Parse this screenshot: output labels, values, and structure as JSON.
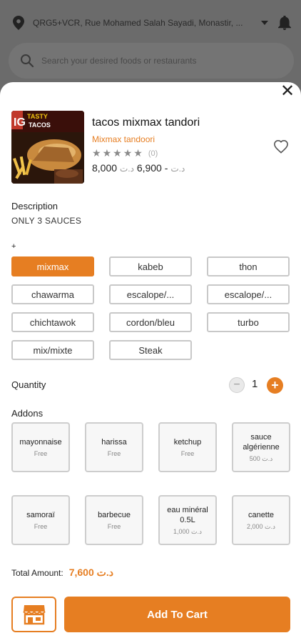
{
  "header": {
    "location": "QRG5+VCR, Rue Mohamed Salah Sayadi, Monastir, ...",
    "search_placeholder": "Search your desired foods or restaurants"
  },
  "product": {
    "name": "tacos mixmax tandori",
    "restaurant": "Mixmax tandoori",
    "rating_count": "(0)",
    "price_max": "8,000",
    "price_min": "6,900",
    "currency": "د.ت",
    "image_brand_line1": "TASTY",
    "image_brand_line2": "TACOS",
    "image_brand_prefix": "IG"
  },
  "description": {
    "label": "Description",
    "text": "ONLY 3 SAUCES"
  },
  "options": {
    "label": "+",
    "items": [
      {
        "label": "mixmax",
        "selected": true
      },
      {
        "label": "kabeb",
        "selected": false
      },
      {
        "label": "thon",
        "selected": false
      },
      {
        "label": "chawarma",
        "selected": false
      },
      {
        "label": "escalope/...",
        "selected": false
      },
      {
        "label": "escalope/...",
        "selected": false
      },
      {
        "label": "chichtawok",
        "selected": false
      },
      {
        "label": "cordon/bleu",
        "selected": false
      },
      {
        "label": "turbo",
        "selected": false
      },
      {
        "label": "mix/mixte",
        "selected": false
      },
      {
        "label": "Steak",
        "selected": false
      }
    ]
  },
  "quantity": {
    "label": "Quantity",
    "value": "1",
    "minus": "−",
    "plus": "+"
  },
  "addons": {
    "label": "Addons",
    "items": [
      {
        "name": "mayonnaise",
        "price": "Free"
      },
      {
        "name": "harissa",
        "price": "Free"
      },
      {
        "name": "ketchup",
        "price": "Free"
      },
      {
        "name": "sauce algérienne",
        "price": "500 د.ت"
      },
      {
        "name": "samoraï",
        "price": "Free"
      },
      {
        "name": "barbecue",
        "price": "Free"
      },
      {
        "name": "eau minéral 0.5L",
        "price": "1,000 د.ت"
      },
      {
        "name": "canette",
        "price": "2,000 د.ت"
      }
    ]
  },
  "total": {
    "label": "Total Amount:",
    "value": "7,600 د.ت"
  },
  "actions": {
    "add_to_cart": "Add To Cart"
  },
  "colors": {
    "accent": "#e67e22"
  }
}
